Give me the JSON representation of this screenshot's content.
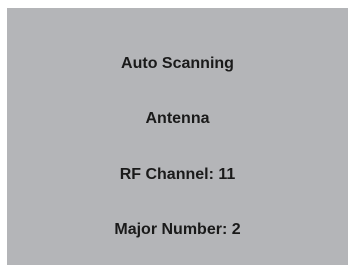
{
  "screen": {
    "lines": [
      "Auto Scanning",
      "Antenna",
      "RF Channel: 11",
      "Major Number: 2"
    ]
  },
  "colors": {
    "background": "#b4b5b8",
    "text": "#1a1a1a"
  }
}
